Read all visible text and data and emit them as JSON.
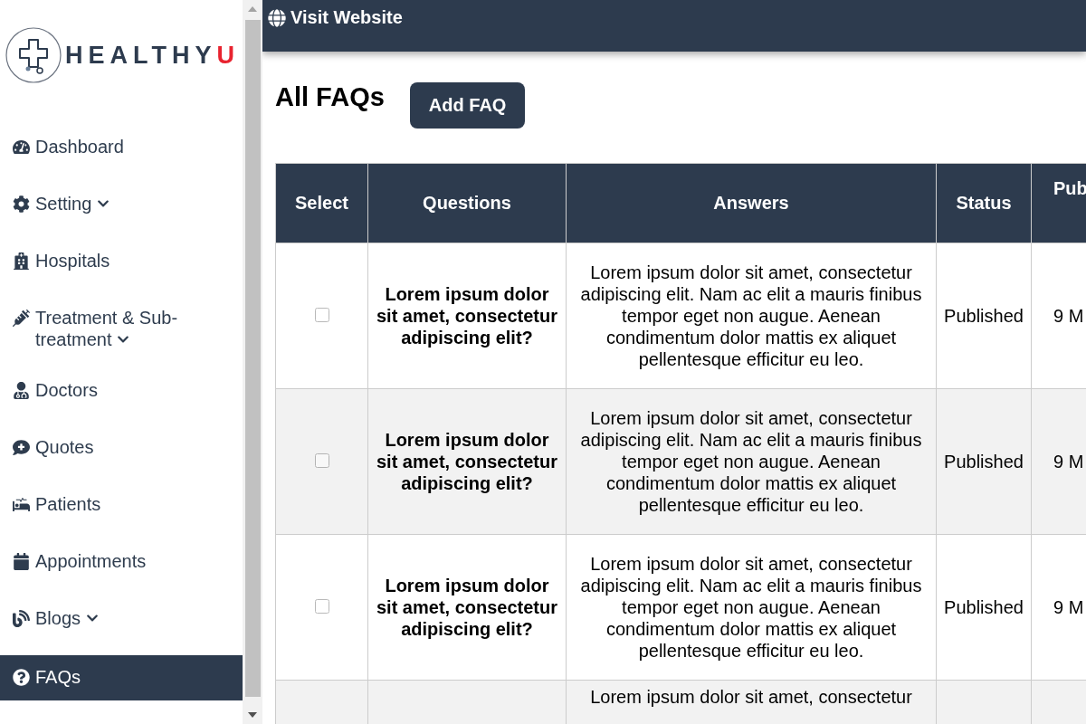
{
  "logo": {
    "text": "HEALTHY",
    "accent": "U"
  },
  "sidebar": {
    "items": [
      {
        "label": "Dashboard",
        "has_submenu": false,
        "selected": false
      },
      {
        "label": "Setting",
        "has_submenu": true,
        "selected": false
      },
      {
        "label": "Hospitals",
        "has_submenu": false,
        "selected": false
      },
      {
        "label": "Treatment & Sub-treatment",
        "has_submenu": true,
        "selected": false
      },
      {
        "label": "Doctors",
        "has_submenu": false,
        "selected": false
      },
      {
        "label": "Quotes",
        "has_submenu": false,
        "selected": false
      },
      {
        "label": "Patients",
        "has_submenu": false,
        "selected": false
      },
      {
        "label": "Appointments",
        "has_submenu": false,
        "selected": false
      },
      {
        "label": "Blogs",
        "has_submenu": true,
        "selected": false
      },
      {
        "label": "FAQs",
        "has_submenu": false,
        "selected": true
      }
    ]
  },
  "topbar": {
    "link": "Visit Website"
  },
  "page": {
    "title": "All FAQs",
    "add_button": "Add FAQ"
  },
  "table": {
    "columns": [
      "Select",
      "Questions",
      "Answers",
      "Status",
      "Pub"
    ],
    "rows": [
      {
        "checked": false,
        "question": "Lorem ipsum dolor sit amet, consectetur adipiscing elit?",
        "answer": "Lorem ipsum dolor sit amet, consectetur adipiscing elit. Nam ac elit a mauris finibus tempor eget non augue. Aenean condimentum dolor mattis ex aliquet pellentesque efficitur eu leo.",
        "status": "Published",
        "published": "9 M"
      },
      {
        "checked": false,
        "question": "Lorem ipsum dolor sit amet, consectetur adipiscing elit?",
        "answer": "Lorem ipsum dolor sit amet, consectetur adipiscing elit. Nam ac elit a mauris finibus tempor eget non augue. Aenean condimentum dolor mattis ex aliquet pellentesque efficitur eu leo.",
        "status": "Published",
        "published": "9 M"
      },
      {
        "checked": false,
        "question": "Lorem ipsum dolor sit amet, consectetur adipiscing elit?",
        "answer": "Lorem ipsum dolor sit amet, consectetur adipiscing elit. Nam ac elit a mauris finibus tempor eget non augue. Aenean condimentum dolor mattis ex aliquet pellentesque efficitur eu leo.",
        "status": "Published",
        "published": "9 M"
      },
      {
        "answer": "Lorem ipsum dolor sit amet, consectetur"
      }
    ]
  }
}
